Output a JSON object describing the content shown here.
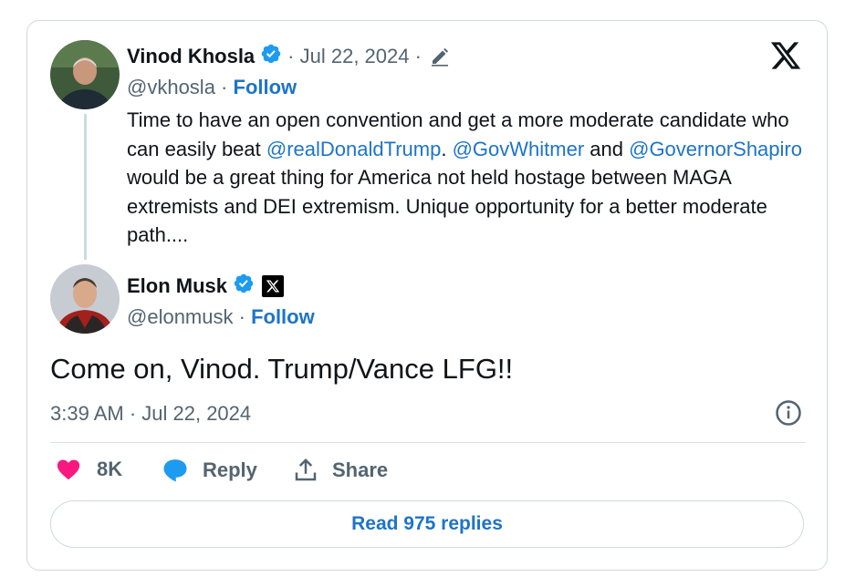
{
  "original_tweet": {
    "author_name": "Vinod Khosla",
    "separator_date": "· Jul 22, 2024 ·",
    "handle": "@vkhosla",
    "follow_label": "Follow",
    "dot": " · ",
    "text_parts": [
      "Time to have an open convention and get a more moderate candidate who can easily beat ",
      "@realDonaldTrump",
      ". ",
      "@GovWhitmer",
      " and ",
      "@GovernorShapiro",
      " would be a great thing for America not held hostage between MAGA extremists and DEI extremism. Unique opportunity for a better moderate path...."
    ]
  },
  "reply_tweet": {
    "author_name": "Elon Musk",
    "handle": "@elonmusk",
    "follow_label": "Follow",
    "dot": " · ",
    "text": "Come on, Vinod. Trump/Vance LFG!!",
    "timestamp": "3:39 AM · Jul 22, 2024"
  },
  "actions": {
    "likes": "8K",
    "reply_label": "Reply",
    "share_label": "Share",
    "read_replies": "Read 975 replies"
  },
  "colors": {
    "accent": "#1d74c8",
    "verified": "#1d9bf0",
    "like": "#f91880",
    "muted": "#536471"
  },
  "icons": [
    "x-logo-icon",
    "verified-badge-icon",
    "edit-pencil-icon",
    "affiliate-x-icon",
    "info-icon",
    "heart-icon",
    "reply-bubble-icon",
    "share-icon"
  ]
}
